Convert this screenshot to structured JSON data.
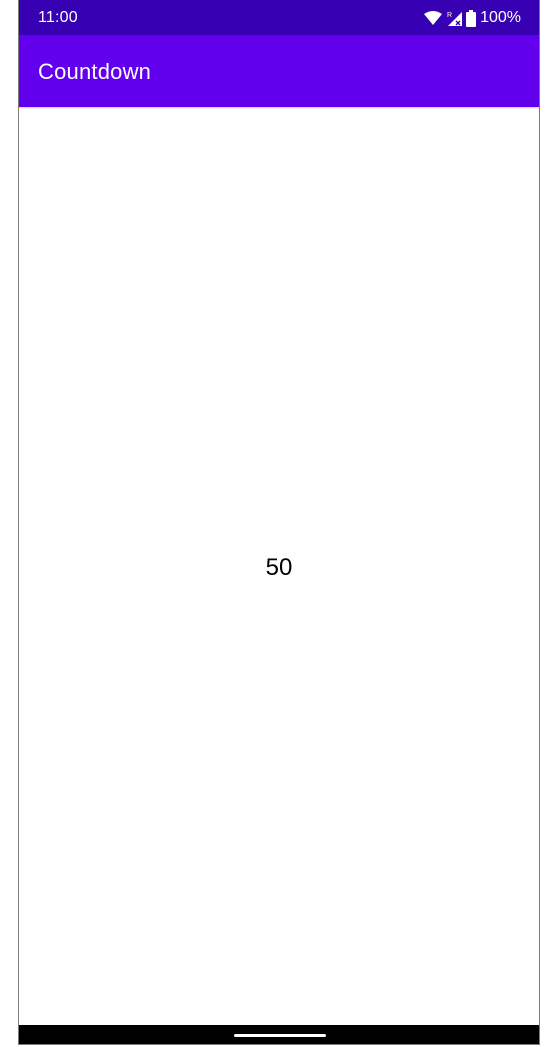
{
  "status_bar": {
    "time": "11:00",
    "battery": "100%",
    "icons": [
      "wifi-icon",
      "signal-icon",
      "battery-icon"
    ],
    "color": "#3700b3"
  },
  "app_bar": {
    "title": "Countdown",
    "color": "#6200ee"
  },
  "main": {
    "countdown_value": "50"
  },
  "nav_bar": {
    "icons": [
      "home-handle"
    ],
    "color": "#000000"
  }
}
